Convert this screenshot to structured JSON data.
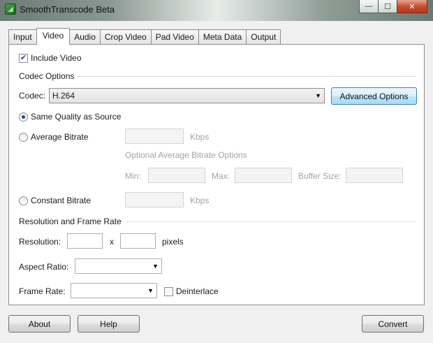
{
  "window": {
    "title": "SmoothTranscode Beta",
    "controls": {
      "minimize": "—",
      "maximize": "☐",
      "close": "✕"
    }
  },
  "tabs": [
    "Input",
    "Video",
    "Audio",
    "Crop Video",
    "Pad Video",
    "Meta Data",
    "Output"
  ],
  "active_tab": "Video",
  "video": {
    "include_video_label": "Include Video",
    "include_video_checked": true,
    "codec_options_header": "Codec Options",
    "codec_label": "Codec:",
    "codec_value": "H.264",
    "advanced_options_label": "Advanced Options",
    "same_quality_label": "Same Quality as Source",
    "average_bitrate_label": "Average Bitrate",
    "average_bitrate_unit": "Kbps",
    "optional_avg_header": "Optional Average Bitrate Options",
    "min_label": "Min:",
    "max_label": "Max:",
    "buffer_size_label": "Buffer Size:",
    "constant_bitrate_label": "Constant Bitrate",
    "constant_bitrate_unit": "Kbps",
    "rate_mode_selected": "same_quality",
    "resolution_header": "Resolution and Frame Rate",
    "resolution_label": "Resolution:",
    "resolution_x": "x",
    "resolution_unit": "pixels",
    "resolution_width": "",
    "resolution_height": "",
    "aspect_ratio_label": "Aspect Ratio:",
    "aspect_ratio_value": "",
    "frame_rate_label": "Frame Rate:",
    "frame_rate_value": "",
    "deinterlace_label": "Deinterlace",
    "deinterlace_checked": false
  },
  "footer": {
    "about_label": "About",
    "help_label": "Help",
    "convert_label": "Convert"
  },
  "colors": {
    "accent": "#3c7fb1",
    "radio_dot": "#1f4f8a",
    "disabled_text": "#a3a3a3"
  },
  "icons": {
    "app": "app-logo-icon",
    "dropdown": "chevron-down-icon",
    "check": "checkmark-icon"
  }
}
